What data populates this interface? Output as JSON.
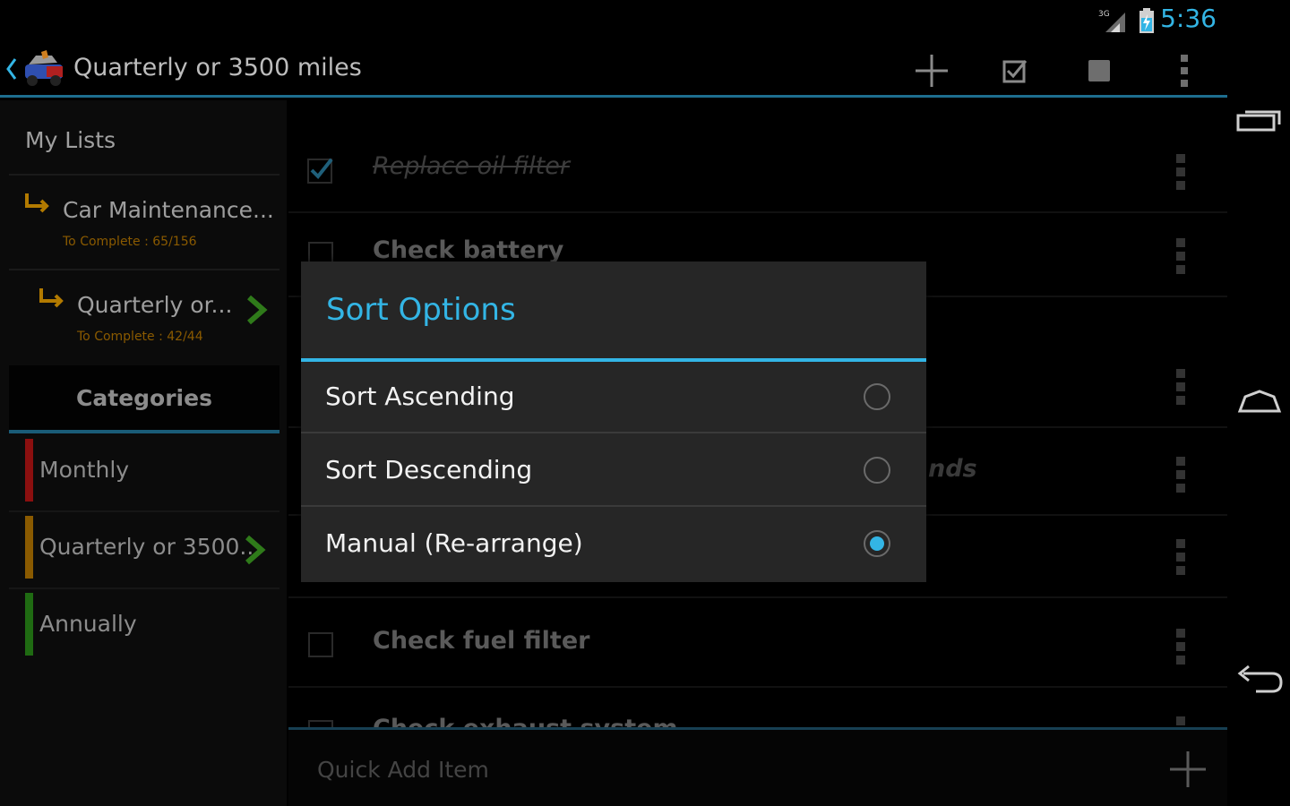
{
  "status": {
    "time": "5:36",
    "network": "3G"
  },
  "actionbar": {
    "title": "Quarterly or 3500 miles",
    "actions": [
      "add-icon",
      "check-all-icon",
      "uncheck-all-icon",
      "overflow-menu-icon"
    ]
  },
  "sidebar": {
    "header": "My Lists",
    "lists": [
      {
        "name": "Car Maintenance...",
        "sub": "To Complete : 65/156"
      },
      {
        "name": "Quarterly or...",
        "sub": "To Complete : 42/44"
      }
    ],
    "categories_header": "Categories",
    "categories": [
      {
        "name": "Monthly",
        "color": "#8b0f0f"
      },
      {
        "name": "Quarterly or 3500...",
        "color": "#8a5a00"
      },
      {
        "name": "Annually",
        "color": "#1f6b12"
      }
    ]
  },
  "main": {
    "items": [
      {
        "text": "Replace oil filter",
        "checked": true
      },
      {
        "text": "Check battery",
        "checked": false
      },
      {
        "text": "",
        "checked": false
      },
      {
        "text": "",
        "checked": false
      },
      {
        "text": "",
        "checked": false
      },
      {
        "text": "Check fuel filter",
        "checked": false
      },
      {
        "text": "Check exhaust system",
        "checked": false
      }
    ],
    "ghost_text": "nds"
  },
  "quick_add": {
    "placeholder": "Quick Add Item"
  },
  "dialog": {
    "title": "Sort Options",
    "options": [
      {
        "label": "Sort Ascending",
        "selected": false
      },
      {
        "label": "Sort Descending",
        "selected": false
      },
      {
        "label": "Manual (Re-arrange)",
        "selected": true
      }
    ]
  },
  "colors": {
    "accent": "#33b5e5",
    "background": "#000000",
    "dialog": "#262626"
  }
}
